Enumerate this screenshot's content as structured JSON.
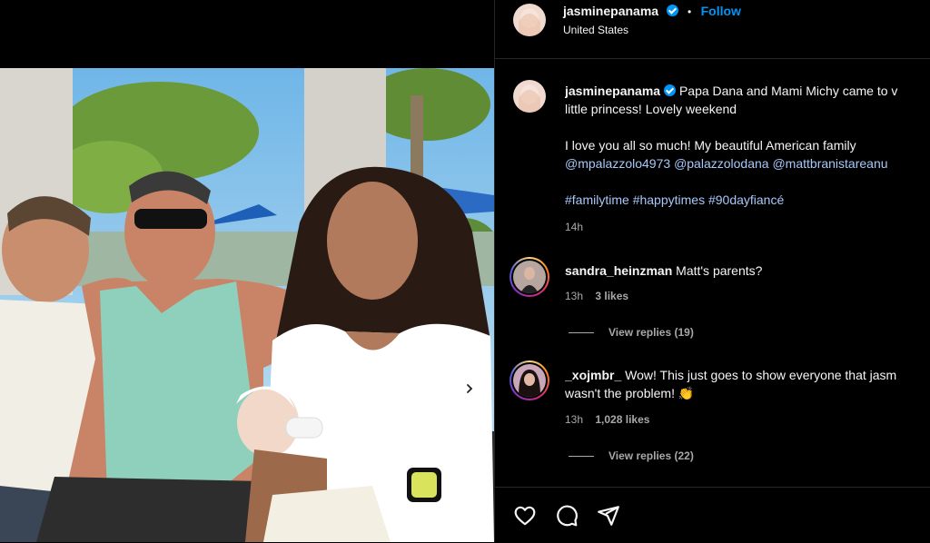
{
  "post": {
    "author": "jasminepanama",
    "follow_label": "Follow",
    "dot": "•",
    "location": "United States",
    "caption": {
      "author": "jasminepanama",
      "line1": "Papa Dana and Mami Michy came to v",
      "line2": "little princess! Lovely weekend",
      "line3": "I love you all so much! My beautiful American family",
      "mentions": [
        "@mpalazzolo4973",
        "@palazzolodana",
        "@mattbranistareanu"
      ],
      "hashtags": [
        "#familytime",
        "#happytimes",
        "#90dayfiancé"
      ],
      "time": "14h"
    }
  },
  "comments": [
    {
      "user": "sandra_heinzman",
      "text": "Matt's parents?",
      "time": "13h",
      "likes": "3 likes",
      "replies_label": "View replies (19)"
    },
    {
      "user": "_xojmbr_",
      "text_line1": "Wow! This just goes to show everyone that jasm",
      "text_line2": "wasn't the problem!",
      "emoji": "👏",
      "time": "13h",
      "likes": "1,028 likes",
      "replies_label": "View replies (22)"
    }
  ],
  "icons": {
    "like": "heart-icon",
    "comment": "comment-icon",
    "share": "send-icon",
    "verified": "verified-badge-icon",
    "carousel": "chevron-right-icon"
  },
  "colors": {
    "accent": "#0095f6",
    "link": "#a8c7fa",
    "background": "#000000",
    "muted": "#a8a8a8"
  }
}
